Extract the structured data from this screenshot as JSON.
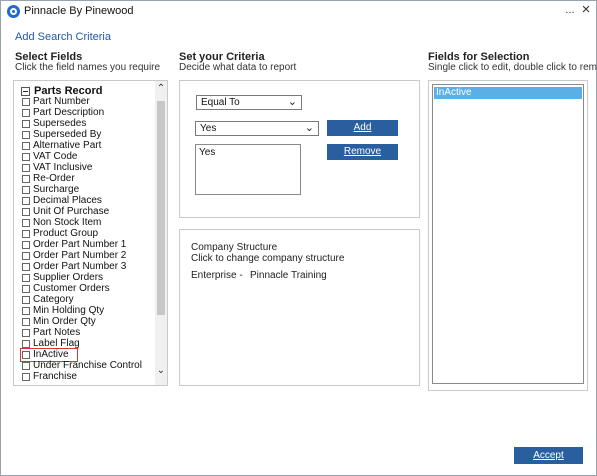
{
  "window": {
    "title": "Pinnacle By Pinewood",
    "menu_dots": "...",
    "close_glyph": "×"
  },
  "panel_title": "Add Search Criteria",
  "select_fields": {
    "heading": "Select Fields",
    "subheading": "Click the field names you require",
    "root_label": "Parts Record",
    "items": [
      "Part Number",
      "Part Description",
      "Supersedes",
      "Superseded By",
      "Alternative Part",
      "VAT Code",
      "VAT Inclusive",
      "Re-Order",
      "Surcharge",
      "Decimal Places",
      "Unit Of Purchase",
      "Non Stock Item",
      "Product Group",
      "Order Part Number 1",
      "Order Part Number 2",
      "Order Part Number 3",
      "Supplier Orders",
      "Customer Orders",
      "Category",
      "Min Holding Qty",
      "Min Order Qty",
      "Part Notes",
      "Label Flag",
      "InActive",
      "Under Franchise Control",
      "Franchise"
    ],
    "highlighted_item": "InActive",
    "scroll_up_glyph": "⌃",
    "scroll_down_glyph": "⌄"
  },
  "criteria": {
    "heading": "Set your Criteria",
    "subheading": "Decide what data to report",
    "operator_value": "Equal To",
    "value_select": "Yes",
    "value_list": [
      "Yes"
    ],
    "add_label": "Add",
    "remove_label": "Remove",
    "chevron_glyph": "⌄"
  },
  "company": {
    "title": "Company Structure",
    "subtitle": "Click to change company structure",
    "enterprise_label": "Enterprise -",
    "enterprise_value": "Pinnacle Training"
  },
  "selection": {
    "heading": "Fields for Selection",
    "subheading": "Single click to edit, double click to remove",
    "items": [
      "InActive"
    ]
  },
  "accept_label": "Accept",
  "colors": {
    "accent_blue": "#2a5f9f",
    "selection_blue": "#5aafe6",
    "title_blue": "#1f5aa6",
    "highlight_red": "#d6373b"
  }
}
